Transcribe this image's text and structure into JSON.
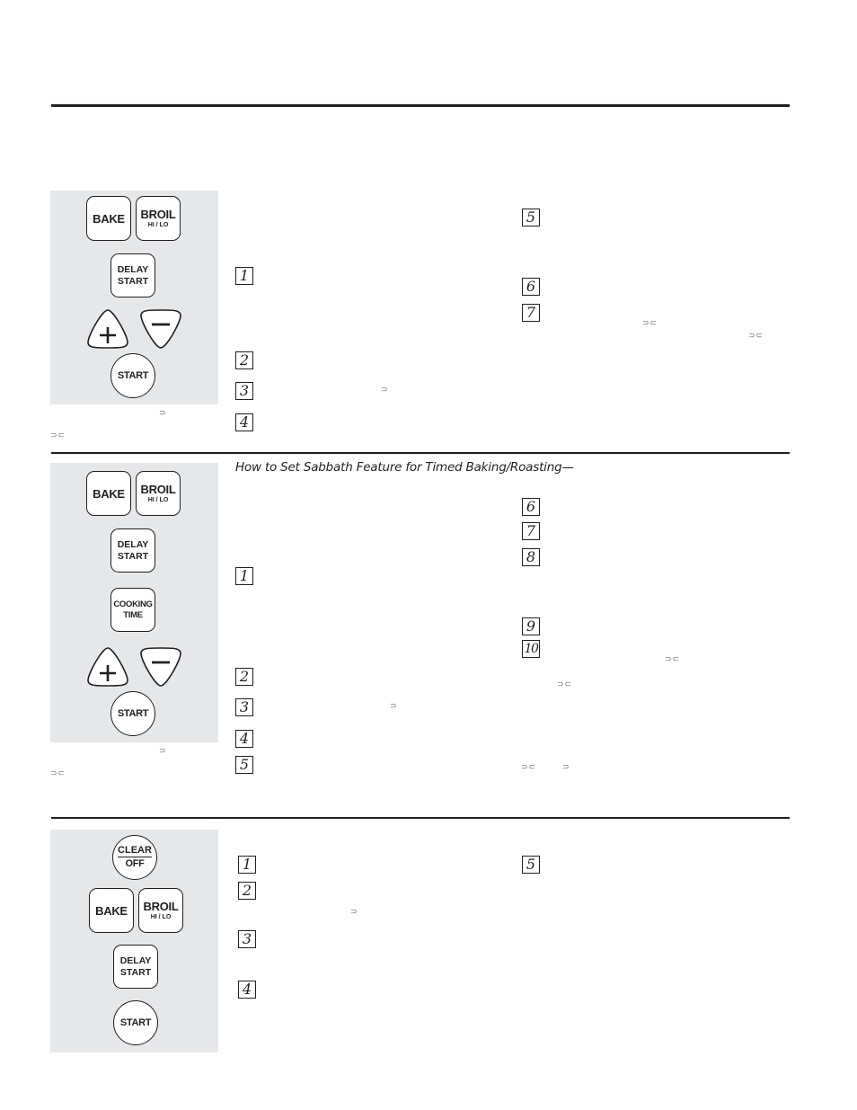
{
  "sections": [
    {
      "keypad": {
        "bake": "BAKE",
        "broil": "BROIL",
        "broil_sub": "HI / LO",
        "delay_line1": "DELAY",
        "delay_line2": "START",
        "plus_icon": "plus",
        "minus_icon": "minus",
        "start": "START"
      },
      "caption_glyphs": [
        "⊃",
        "⊃⊂"
      ],
      "steps": [
        "1",
        "2",
        "3",
        "4",
        "5",
        "6",
        "7"
      ],
      "inline_glyphs": [
        "⊃",
        "⊃⊂",
        "⊃⊂"
      ]
    },
    {
      "heading": "How to Set Sabbath Feature for Timed Baking/Roasting—",
      "keypad": {
        "bake": "BAKE",
        "broil": "BROIL",
        "broil_sub": "HI / LO",
        "delay_line1": "DELAY",
        "delay_line2": "START",
        "cooking_line1": "COOKING",
        "cooking_line2": "TIME",
        "plus_icon": "plus",
        "minus_icon": "minus",
        "start": "START"
      },
      "caption_glyphs": [
        "⊃",
        "⊃⊂"
      ],
      "steps": [
        "1",
        "2",
        "3",
        "4",
        "5",
        "6",
        "7",
        "8",
        "9",
        "10"
      ],
      "inline_glyphs": [
        "⊃",
        "⊃⊂",
        "⊃⊂",
        "⊃⊂",
        "⊃"
      ]
    },
    {
      "keypad": {
        "clear_line1": "CLEAR",
        "clear_line2": "OFF",
        "bake": "BAKE",
        "broil": "BROIL",
        "broil_sub": "HI / LO",
        "delay_line1": "DELAY",
        "delay_line2": "START",
        "start": "START"
      },
      "steps": [
        "1",
        "2",
        "3",
        "4",
        "5"
      ],
      "inline_glyphs": [
        "⊃"
      ]
    }
  ]
}
